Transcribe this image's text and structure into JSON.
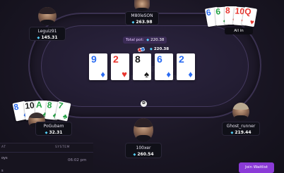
{
  "table": {
    "total_pot_label": "Total pot:",
    "total_pot_value": "220.38",
    "pot_amount": "220.38",
    "dealer_label": "D",
    "board": [
      {
        "rank": "9",
        "suit": "♦",
        "color": "#2a6bf2"
      },
      {
        "rank": "2",
        "suit": "♥",
        "color": "#e8362f"
      },
      {
        "rank": "8",
        "suit": "♠",
        "color": "#1a1a1a"
      },
      {
        "rank": "6",
        "suit": "♦",
        "color": "#2a6bf2"
      },
      {
        "rank": "2",
        "suit": "♦",
        "color": "#2a6bf2"
      }
    ]
  },
  "players": {
    "top_left": {
      "name": "Leguiz91",
      "stack": "145.31"
    },
    "top_center": {
      "name": "M80leSON",
      "stack": "263.98"
    },
    "top_right": {
      "status": "All in"
    },
    "left": {
      "name": "PoGubam",
      "stack": "32.31"
    },
    "right": {
      "name": "Ghost_runner",
      "stack": "219.44"
    },
    "bottom": {
      "name": "100xer",
      "stack": "260.54"
    }
  },
  "top_right_cards": [
    {
      "rank": "6",
      "suit": "♦",
      "color": "#2a6bf2"
    },
    {
      "rank": "6",
      "suit": "♣",
      "color": "#23a244"
    },
    {
      "rank": "8",
      "suit": "♥",
      "color": "#e8362f"
    },
    {
      "rank": "10",
      "suit": "♥",
      "color": "#e8362f"
    },
    {
      "rank": "Q",
      "suit": "♥",
      "color": "#e8362f"
    }
  ],
  "left_cards": [
    {
      "rank": "8",
      "suit": "♦",
      "color": "#2a6bf2"
    },
    {
      "rank": "10",
      "suit": "♠",
      "color": "#1a1a1a"
    },
    {
      "rank": "A",
      "suit": "♣",
      "color": "#23a244"
    },
    {
      "rank": "8",
      "suit": "♣",
      "color": "#23a244"
    },
    {
      "rank": "7",
      "suit": "♣",
      "color": "#23a244"
    }
  ],
  "chat": {
    "tab_left": "AT",
    "tab_right": "SYSTEM",
    "row1": "oys",
    "time": "06:02 pm",
    "row2": "s"
  },
  "waitlist_label": "Join Waitlist",
  "accent_color": "#8a3ad6"
}
